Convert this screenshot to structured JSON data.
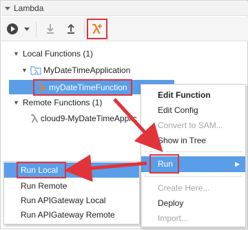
{
  "panel": {
    "title": "Lambda"
  },
  "toolbar": {
    "buttons": [
      {
        "icon": "play-circle-icon"
      },
      {
        "icon": "chevron-down-icon"
      },
      {
        "icon": "download-arrow-icon"
      },
      {
        "icon": "upload-arrow-icon"
      },
      {
        "icon": "lambda-plus-icon"
      }
    ]
  },
  "tree": {
    "local_functions": "Local Functions (1)",
    "application": "MyDateTimeApplication",
    "selected_function": "myDateTimeFunction",
    "remote_functions": "Remote Functions (1)",
    "remote_function": "cloud9-MyDateTimeApplic"
  },
  "context_menu": {
    "items": [
      {
        "label": "Edit Function",
        "bold": true,
        "enabled": true
      },
      {
        "label": "Edit Config",
        "enabled": true
      },
      {
        "label": "Convert to SAM...",
        "enabled": false
      },
      {
        "label": "Show in Tree",
        "enabled": true
      },
      {
        "label": "Run",
        "enabled": true,
        "submenu": true
      },
      {
        "label": "Create Here...",
        "enabled": false
      },
      {
        "label": "Deploy",
        "enabled": true
      },
      {
        "label": "Import...",
        "enabled": false
      }
    ]
  },
  "run_submenu": {
    "items": [
      {
        "label": "Run Local"
      },
      {
        "label": "Run Remote"
      },
      {
        "label": "Run APIGateway Local"
      },
      {
        "label": "Run APIGateway Remote"
      }
    ]
  },
  "colors": {
    "highlight": "#5b9ee8",
    "annotation_red": "#e0333a",
    "lambda_orange": "#f07d1e",
    "folder_blue": "#6fa8dc"
  }
}
